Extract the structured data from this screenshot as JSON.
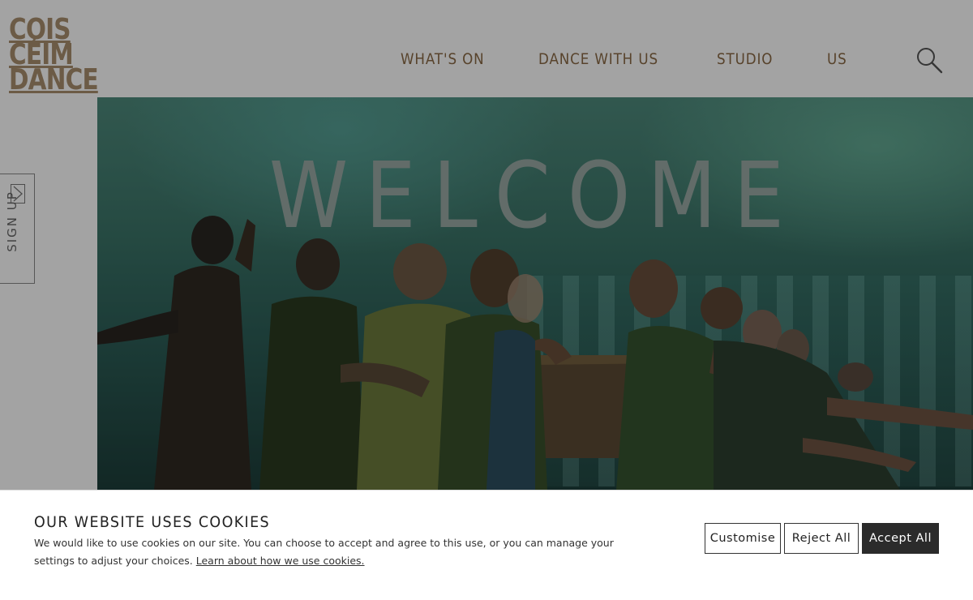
{
  "logo": {
    "lines": [
      "COIS",
      "CÉIM",
      "DANCE"
    ],
    "color": "#a98f6e"
  },
  "nav": {
    "items": [
      "WHAT'S ON",
      "DANCE WITH US",
      "STUDIO",
      "US"
    ],
    "color": "#8a6a45",
    "search_icon": "search-icon"
  },
  "signup": {
    "label": "SIGN UP",
    "icon": "chevron-right-icon"
  },
  "hero": {
    "title": "WELCOME"
  },
  "cookie_banner": {
    "title": "OUR WEBSITE USES COOKIES",
    "body": "We would like to use cookies on our site. You can choose to accept and agree to this use, or you can manage your settings to adjust your choices.",
    "link": "Learn about how we use cookies.",
    "buttons": {
      "customise": "Customise",
      "reject": "Reject All",
      "accept": "Accept All"
    },
    "accept_color": "#2b2b2b"
  }
}
